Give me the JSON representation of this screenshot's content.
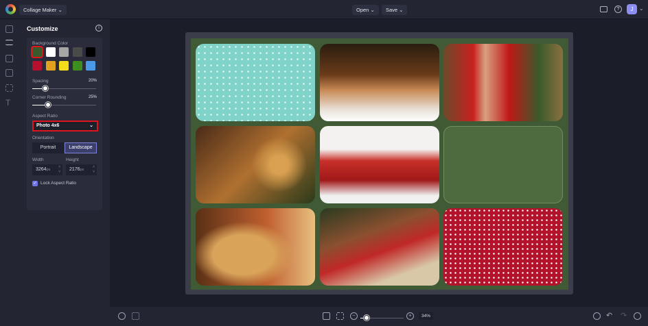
{
  "topbar": {
    "app_menu": "Collage Maker",
    "open": "Open",
    "save": "Save",
    "avatar": "J"
  },
  "panel": {
    "title": "Customize",
    "background_color_label": "Background Color",
    "swatches": [
      "#3a5a2c",
      "#ffffff",
      "#a6a6a6",
      "#4a4a4a",
      "#000000",
      "#b5112e",
      "#e2a21f",
      "#f5dc1a",
      "#3f8c1f",
      "#4a9ae8"
    ],
    "spacing_label": "Spacing",
    "spacing_value": "20%",
    "spacing_fraction": 0.2,
    "rounding_label": "Corner Rounding",
    "rounding_value": "25%",
    "rounding_fraction": 0.25,
    "aspect_label": "Aspect Ratio",
    "aspect_value": "Photo 4x6",
    "orientation_label": "Orientation",
    "portrait": "Portrait",
    "landscape": "Landscape",
    "width_label": "Width",
    "width_value": "3264",
    "height_label": "Height",
    "height_value": "2176",
    "unit": "px",
    "lock_label": "Lock Aspect Ratio"
  },
  "collage": {
    "cells": [
      "mint-pattern",
      "gingerbread-houses",
      "kids-in-santa-suits",
      "ornament-dog",
      "family-in-red",
      "empty-green",
      "golden-retriever",
      "gift-boxes",
      "red-dot-pattern"
    ]
  },
  "bottombar": {
    "zoom": "34%",
    "zoom_fraction": 0.1
  }
}
